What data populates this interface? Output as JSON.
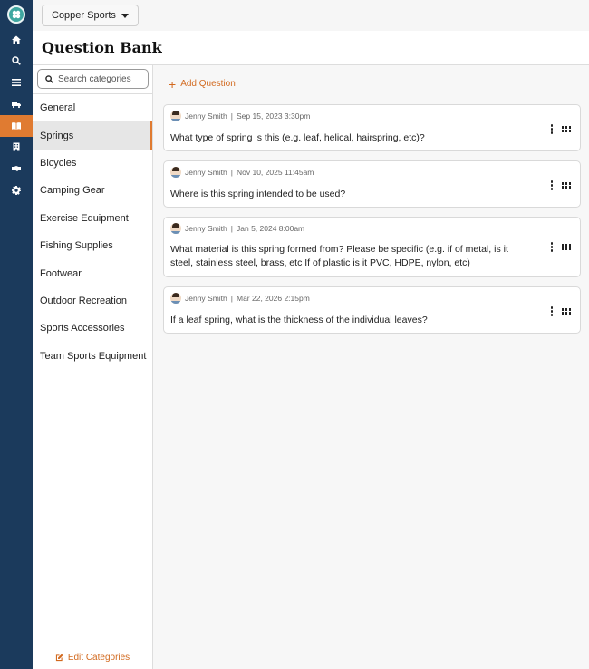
{
  "org": {
    "name": "Copper Sports"
  },
  "page": {
    "title": "Question Bank"
  },
  "nav_icons": [
    "home-icon",
    "search-icon",
    "list-icon",
    "truck-icon",
    "book-icon",
    "building-icon",
    "handshake-icon",
    "gear-icon"
  ],
  "active_nav": "book-icon",
  "categories": {
    "search_placeholder": "Search categories",
    "items": [
      "General",
      "Springs",
      "Bicycles",
      "Camping Gear",
      "Exercise Equipment",
      "Fishing Supplies",
      "Footwear",
      "Outdoor Recreation",
      "Sports Accessories",
      "Team Sports Equipment"
    ],
    "active": "Springs",
    "edit_label": "Edit Categories"
  },
  "main": {
    "add_label": "Add Question",
    "questions": [
      {
        "author": "Jenny Smith",
        "date": "Sep 15, 2023 3:30pm",
        "text": "What type of spring is this (e.g. leaf, helical, hairspring, etc)?"
      },
      {
        "author": "Jenny Smith",
        "date": "Nov 10, 2025 11:45am",
        "text": "Where is this spring intended to be used?"
      },
      {
        "author": "Jenny Smith",
        "date": "Jan 5, 2024 8:00am",
        "text": "What material is this spring formed from? Please be specific (e.g. if of metal, is it steel, stainless steel, brass, etc If of plastic is it PVC, HDPE, nylon, etc)"
      },
      {
        "author": "Jenny Smith",
        "date": "Mar 22, 2026 2:15pm",
        "text": "If a leaf spring, what is the thickness of the individual leaves?"
      }
    ]
  },
  "colors": {
    "rail": "#1b3a5c",
    "accent": "#e07b31",
    "link": "#d2691e"
  }
}
